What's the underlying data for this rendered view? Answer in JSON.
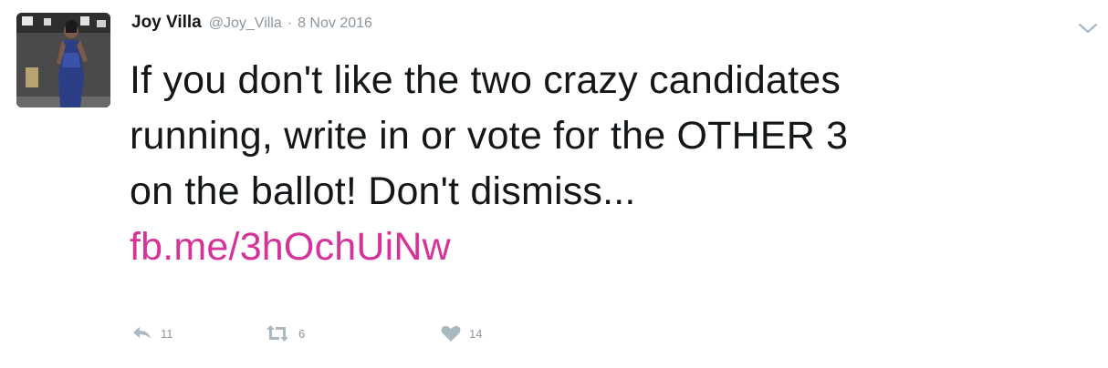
{
  "tweet": {
    "author": {
      "name": "Joy Villa",
      "handle": "@Joy_Villa",
      "separator": "·",
      "date": "8 Nov 2016"
    },
    "text_lines": [
      "If you don't like the two crazy candidates",
      "running, write in or vote for the OTHER 3",
      "on the ballot! Don't dismiss..."
    ],
    "link": "fb.me/3hOchUiNw",
    "actions": {
      "reply": {
        "icon": "reply-icon",
        "count": "11"
      },
      "retweet": {
        "icon": "retweet-icon",
        "count": "6"
      },
      "like": {
        "icon": "heart-icon",
        "count": "14"
      }
    },
    "menu_icon": "chevron-down-icon"
  },
  "colors": {
    "text": "#14171a",
    "muted": "#8c979f",
    "link": "#d6339a",
    "icon": "#aab8c2"
  }
}
